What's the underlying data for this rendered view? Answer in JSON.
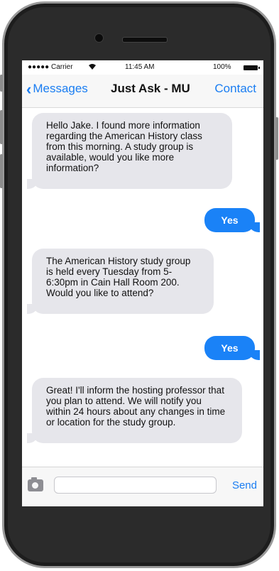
{
  "status_bar": {
    "carrier": "●●●●● Carrier",
    "time": "11:45 AM",
    "battery": "100%"
  },
  "nav": {
    "back_label": "Messages",
    "title": "Just Ask - MU",
    "contact_label": "Contact"
  },
  "messages": [
    {
      "from": "them",
      "text": "Hello Jake. I found more information regarding the American History class from this morning. A study group is available, would you like more information?"
    },
    {
      "from": "me",
      "text": "Yes"
    },
    {
      "from": "them",
      "text": "The American History study group is held every Tuesday from 5-6:30pm in Cain Hall Room 200. Would you like to attend?"
    },
    {
      "from": "me",
      "text": "Yes"
    },
    {
      "from": "them",
      "text": "Great! I'll inform the hosting professor that you plan to attend. We will notify you within 24 hours about any changes in time or location for the study group."
    }
  ],
  "composer": {
    "value": "",
    "send_label": "Send"
  },
  "colors": {
    "accent": "#1a7df2",
    "incoming_bubble": "#e6e6eb",
    "outgoing_bubble": "#1a82f7",
    "phone_body": "#2b2b2b"
  },
  "icons": {
    "camera": "camera-icon",
    "back": "chevron-left-icon",
    "wifi": "wifi-icon",
    "battery": "battery-icon"
  }
}
